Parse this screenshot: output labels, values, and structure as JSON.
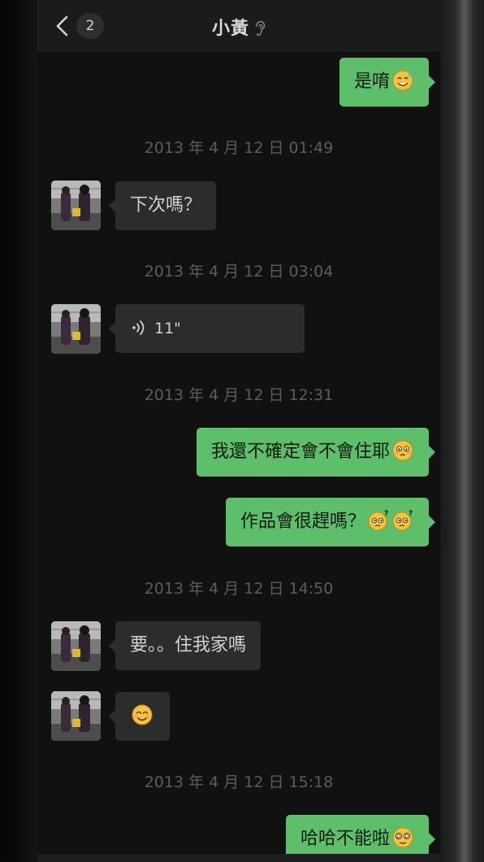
{
  "header": {
    "title": "小黃",
    "unread_count": "2",
    "back_icon": "chevron-left-icon",
    "title_icon": "ear-icon"
  },
  "messages": [
    {
      "type": "out",
      "text": "是唷",
      "emoji": "sweat-smile-emoji"
    },
    {
      "type": "timestamp",
      "text": "2013 年 4 月 12 日 01:49"
    },
    {
      "type": "in",
      "text": "下次嗎？"
    },
    {
      "type": "timestamp",
      "text": "2013 年 4 月 12 日 03:04"
    },
    {
      "type": "in-voice",
      "duration": "11\""
    },
    {
      "type": "timestamp",
      "text": "2013 年 4 月 12 日 12:31"
    },
    {
      "type": "out",
      "text": "我還不確定會不會住耶",
      "emoji": "flushed-emoji"
    },
    {
      "type": "out",
      "text": "作品會很趕嗎？",
      "emoji": "confused-emoji x2"
    },
    {
      "type": "timestamp",
      "text": "2013 年 4 月 12 日 14:50"
    },
    {
      "type": "in",
      "text": "要。。住我家嗎"
    },
    {
      "type": "in-emoji",
      "emoji": "smile-emoji"
    },
    {
      "type": "timestamp",
      "text": "2013 年 4 月 12 日 15:18"
    },
    {
      "type": "out",
      "text": "哈哈不能啦",
      "emoji": "dizzy-eyes-emoji"
    }
  ],
  "colors": {
    "outgoing_bubble": "#5ebf6a",
    "incoming_bubble": "#2c2c2c",
    "background": "#111111",
    "timestamp_text": "#5c5c5c"
  }
}
